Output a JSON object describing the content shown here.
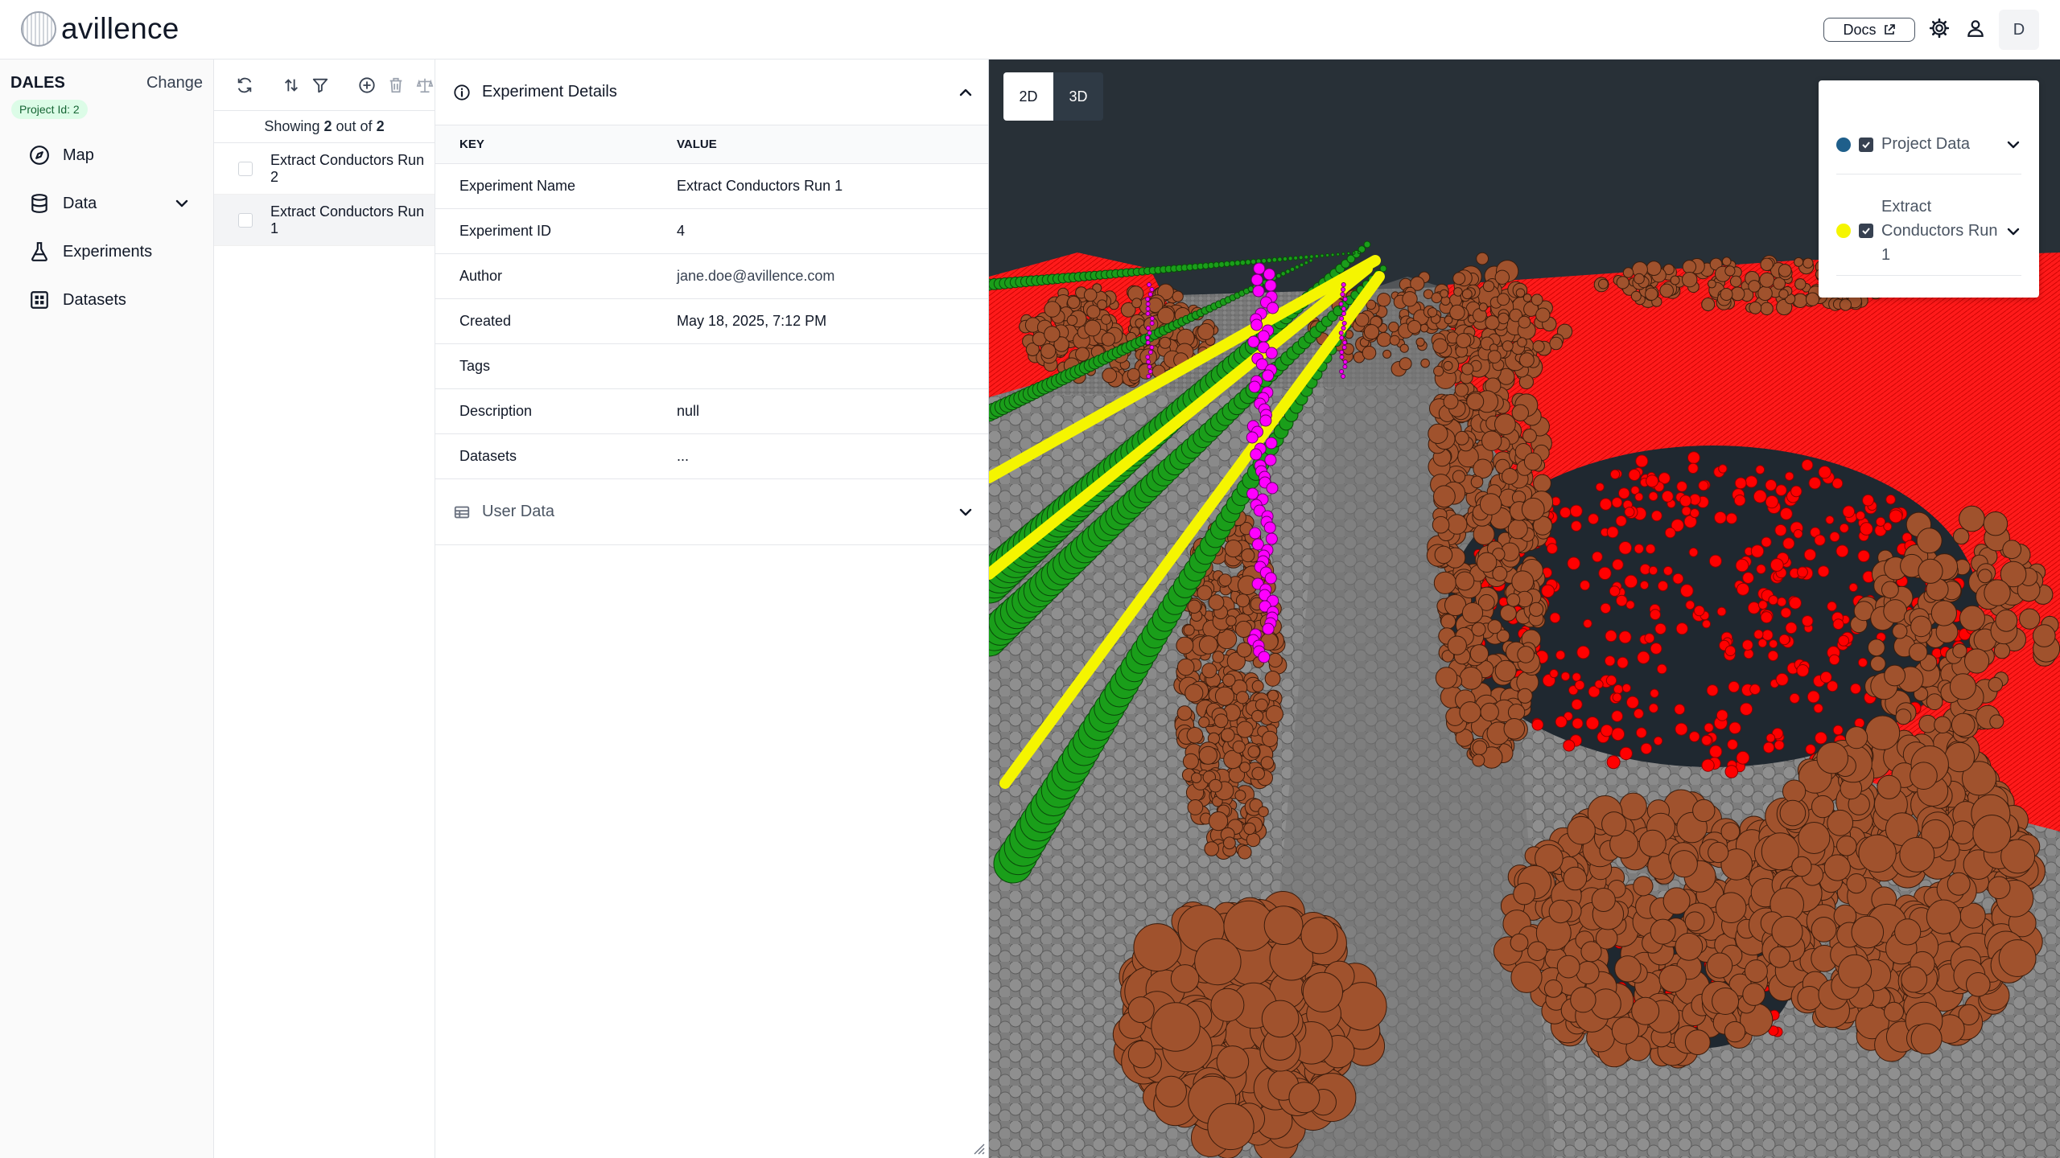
{
  "header": {
    "brand": "avillence",
    "docs_label": "Docs",
    "avatar_initial": "D"
  },
  "sidebar": {
    "project_name": "DALES",
    "change_label": "Change",
    "project_badge": "Project Id: 2",
    "items": [
      {
        "label": "Map",
        "icon": "compass-icon"
      },
      {
        "label": "Data",
        "icon": "database-icon"
      },
      {
        "label": "Experiments",
        "icon": "flask-icon"
      },
      {
        "label": "Datasets",
        "icon": "grid-icon"
      }
    ]
  },
  "list": {
    "showing_prefix": "Showing",
    "showing_count": "2",
    "showing_mid": "out of",
    "showing_total": "2",
    "rows": [
      {
        "label": "Extract Conductors Run 2",
        "selected": false
      },
      {
        "label": "Extract Conductors Run 1",
        "selected": true
      }
    ]
  },
  "details": {
    "title": "Experiment Details",
    "col_key": "KEY",
    "col_value": "VALUE",
    "rows": [
      {
        "key": "Experiment Name",
        "value": "Extract Conductors Run 1"
      },
      {
        "key": "Experiment ID",
        "value": "4"
      },
      {
        "key": "Author",
        "value": "jane.doe@avillence.com"
      },
      {
        "key": "Created",
        "value": "May 18, 2025, 7:12 PM"
      },
      {
        "key": "Tags",
        "value": ""
      },
      {
        "key": "Description",
        "value": "null"
      },
      {
        "key": "Datasets",
        "value": "..."
      }
    ],
    "user_data_title": "User Data"
  },
  "viewer": {
    "mode_2d": "2D",
    "mode_3d": "3D",
    "active_mode": "2D",
    "layers": [
      {
        "label": "Project Data",
        "color": "#1f5f8b",
        "checked": true
      },
      {
        "label_lines": [
          "Extract",
          "Conductors Run",
          "1"
        ],
        "color": "#f5f500",
        "checked": true
      }
    ]
  },
  "colors": {
    "ground": "#8a8a8a",
    "vegetation": "#a0522d",
    "building": "#ff0000",
    "conductor": "#f5f500",
    "pole": "#ff00ff",
    "wire": "#1a9e1a"
  }
}
